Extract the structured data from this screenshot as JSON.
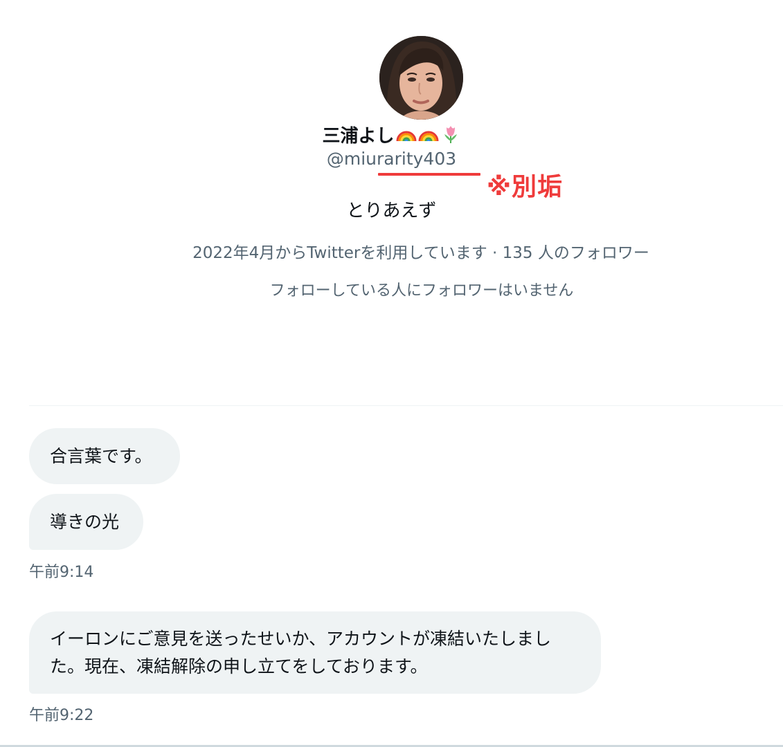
{
  "profile": {
    "display_name": "三浦よし",
    "name_emojis": [
      "rainbow-icon",
      "rainbow-icon",
      "tulip-icon"
    ],
    "handle": "@miurarity403",
    "annotation": "※別垢",
    "bio": "とりあえず",
    "meta": "2022年4月からTwitterを利用しています · 135 人のフォロワー",
    "followers_note": "フォローしている人にフォロワーはいません"
  },
  "colors": {
    "annotation_red": "#ef3b3b",
    "bubble_bg": "#eff3f4",
    "secondary_text": "#536471",
    "primary_text": "#0f1419"
  },
  "messages": [
    {
      "text": "合言葉です。"
    },
    {
      "text": "導きの光"
    },
    {
      "timestamp": "午前9:14"
    },
    {
      "text": "イーロンにご意見を送ったせいか、アカウントが凍結いたしました。現在、凍結解除の申し立てをしております。"
    },
    {
      "timestamp": "午前9:22"
    }
  ]
}
